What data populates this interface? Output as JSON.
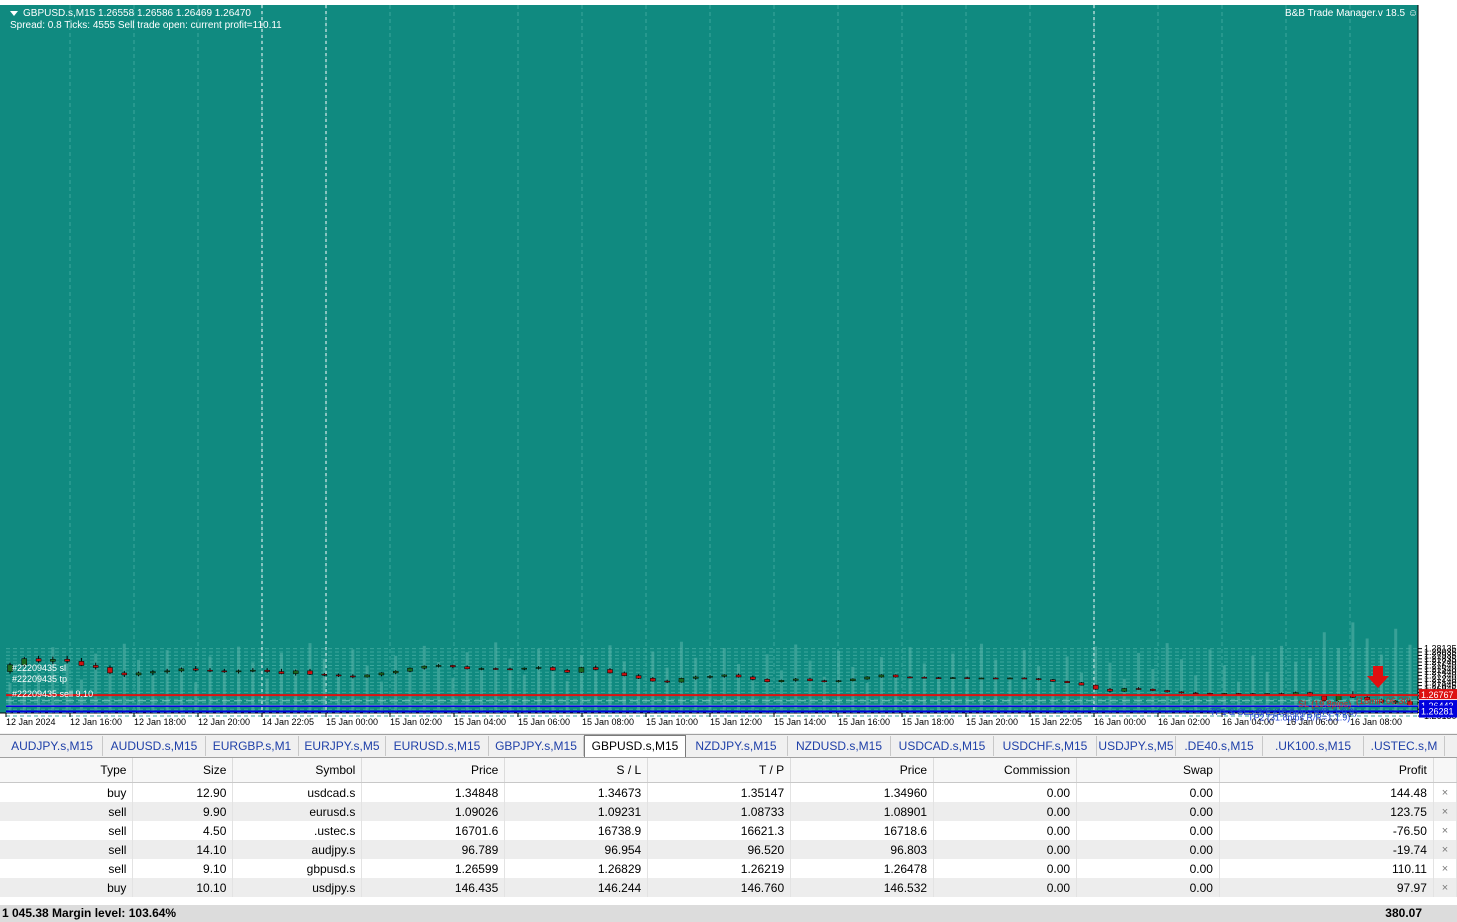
{
  "chart": {
    "symbol_line": "GBPUSD.s,M15  1.26558 1.26586 1.26469 1.26470",
    "status_line": "Spread: 0.8  Ticks: 4555  Sell trade open: current profit=110.11",
    "manager_label": "B&B Trade Manager.v 18.5",
    "line_labels": {
      "sl": "#22209435 sl",
      "entry": "#22209435 sell 9.10",
      "tp": "#22209435 tp",
      "sl_tag": "SL (19.8pips)",
      "tp1": "TP1 & SL->B/E (15.6pips R/R=1:0.9)",
      "tp2": "TP2 (31.8pips R/R=1:1.9)",
      "countdown": "(16min 06.30)"
    },
    "price_ticks": [
      "1.28135",
      "1.28035",
      "1.27935",
      "1.27835",
      "1.27740",
      "1.27640",
      "1.27540",
      "1.27440",
      "1.27340",
      "1.27240",
      "1.27140",
      "1.27045",
      "1.26945",
      "1.26845",
      "1.26745",
      "1.26645",
      "1.26545",
      "1.26350",
      "1.26250",
      "1.26150"
    ],
    "price_tags": {
      "sl": "1.26767",
      "current": "1.26470",
      "tp1": "1.26443",
      "tp2": "1.26281"
    },
    "time_labels": [
      "12 Jan 2024",
      "12 Jan 16:00",
      "12 Jan 18:00",
      "12 Jan 20:00",
      "14 Jan 22:05",
      "15 Jan 00:00",
      "15 Jan 02:00",
      "15 Jan 04:00",
      "15 Jan 06:00",
      "15 Jan 08:00",
      "15 Jan 10:00",
      "15 Jan 12:00",
      "15 Jan 14:00",
      "15 Jan 16:00",
      "15 Jan 18:00",
      "15 Jan 20:00",
      "15 Jan 22:05",
      "16 Jan 00:00",
      "16 Jan 02:00",
      "16 Jan 04:00",
      "16 Jan 06:00",
      "16 Jan 08:00"
    ],
    "colors": {
      "background": "#108a80",
      "bull": "#1e6a1e",
      "bear": "#cc1111",
      "sl_line": "#dd1111",
      "tp_line": "#0000dd",
      "text": "#ffffff"
    }
  },
  "tabs": [
    "AUDJPY.s,M15",
    "AUDUSD.s,M15",
    "EURGBP.s,M1",
    "EURJPY.s,M5",
    "EURUSD.s,M15",
    "GBPJPY.s,M15",
    "GBPUSD.s,M15",
    "NZDJPY.s,M15",
    "NZDUSD.s,M15",
    "USDCAD.s,M15",
    "USDCHF.s,M15",
    "USDJPY.s,M5",
    ".DE40.s,M15",
    ".UK100.s,M15",
    ".USTEC.s,M"
  ],
  "active_tab": 6,
  "table": {
    "headers": [
      "Type",
      "Size",
      "Symbol",
      "Price",
      "S / L",
      "T / P",
      "Price",
      "Commission",
      "Swap",
      "Profit"
    ],
    "rows": [
      [
        "buy",
        "12.90",
        "usdcad.s",
        "1.34848",
        "1.34673",
        "1.35147",
        "1.34960",
        "0.00",
        "0.00",
        "144.48"
      ],
      [
        "sell",
        "9.90",
        "eurusd.s",
        "1.09026",
        "1.09231",
        "1.08733",
        "1.08901",
        "0.00",
        "0.00",
        "123.75"
      ],
      [
        "sell",
        "4.50",
        ".ustec.s",
        "16701.6",
        "16738.9",
        "16621.3",
        "16718.6",
        "0.00",
        "0.00",
        "-76.50"
      ],
      [
        "sell",
        "14.10",
        "audjpy.s",
        "96.789",
        "96.954",
        "96.520",
        "96.803",
        "0.00",
        "0.00",
        "-19.74"
      ],
      [
        "sell",
        "9.10",
        "gbpusd.s",
        "1.26599",
        "1.26829",
        "1.26219",
        "1.26478",
        "0.00",
        "0.00",
        "110.11"
      ],
      [
        "buy",
        "10.10",
        "usdjpy.s",
        "146.435",
        "146.244",
        "146.760",
        "146.532",
        "0.00",
        "0.00",
        "97.97"
      ]
    ],
    "close_glyph": "×"
  },
  "footer": {
    "margin_text": "1 045.38  Margin level: 103.64%",
    "total_profit": "380.07"
  },
  "chart_data": {
    "type": "candlestick",
    "series": [
      {
        "ohlc": [
          [
            1.2746,
            1.2772,
            1.274,
            1.2766
          ],
          [
            1.2766,
            1.2789,
            1.276,
            1.2784
          ],
          [
            1.2784,
            1.2792,
            1.2772,
            1.2776
          ],
          [
            1.2776,
            1.279,
            1.2768,
            1.2782
          ],
          [
            1.2782,
            1.2792,
            1.277,
            1.2776
          ],
          [
            1.2776,
            1.2786,
            1.2762,
            1.2764
          ],
          [
            1.2764,
            1.2772,
            1.2752,
            1.2758
          ],
          [
            1.2758,
            1.2764,
            1.2738,
            1.2742
          ],
          [
            1.2742,
            1.2748,
            1.273,
            1.2736
          ],
          [
            1.2736,
            1.2746,
            1.2732,
            1.2742
          ],
          [
            1.2742,
            1.275,
            1.2736,
            1.2746
          ],
          [
            1.2746,
            1.2754,
            1.274,
            1.2748
          ],
          [
            1.2748,
            1.2758,
            1.2744,
            1.2754
          ],
          [
            1.2754,
            1.2762,
            1.2746,
            1.275
          ],
          [
            1.275,
            1.2756,
            1.2744,
            1.2748
          ],
          [
            1.2748,
            1.2754,
            1.2742,
            1.2746
          ],
          [
            1.2746,
            1.2752,
            1.274,
            1.2748
          ],
          [
            1.2748,
            1.2756,
            1.2744,
            1.275
          ],
          [
            1.275,
            1.2756,
            1.2742,
            1.2746
          ],
          [
            1.2746,
            1.2754,
            1.2738,
            1.274
          ],
          [
            1.274,
            1.2752,
            1.2734,
            1.2748
          ],
          [
            1.2748,
            1.2754,
            1.2736,
            1.2738
          ],
          [
            1.2738,
            1.2742,
            1.2732,
            1.2736
          ],
          [
            1.2736,
            1.274,
            1.273,
            1.2733
          ],
          [
            1.2733,
            1.2738,
            1.2726,
            1.273
          ],
          [
            1.273,
            1.2738,
            1.2728,
            1.2736
          ],
          [
            1.2736,
            1.2744,
            1.2732,
            1.2742
          ],
          [
            1.2742,
            1.275,
            1.2738,
            1.2747
          ],
          [
            1.2747,
            1.2758,
            1.2744,
            1.2756
          ],
          [
            1.2756,
            1.2764,
            1.2752,
            1.2762
          ],
          [
            1.2762,
            1.2768,
            1.2758,
            1.2764
          ],
          [
            1.2764,
            1.2766,
            1.2756,
            1.276
          ],
          [
            1.276,
            1.2764,
            1.2752,
            1.2754
          ],
          [
            1.2754,
            1.2758,
            1.275,
            1.2755
          ],
          [
            1.2755,
            1.2758,
            1.2751,
            1.2754
          ],
          [
            1.2754,
            1.2758,
            1.275,
            1.2753
          ],
          [
            1.2753,
            1.2758,
            1.275,
            1.2756
          ],
          [
            1.2756,
            1.2762,
            1.2752,
            1.2758
          ],
          [
            1.2758,
            1.2762,
            1.2748,
            1.275
          ],
          [
            1.275,
            1.2754,
            1.2742,
            1.2744
          ],
          [
            1.2744,
            1.276,
            1.2742,
            1.2758
          ],
          [
            1.2758,
            1.2764,
            1.275,
            1.2752
          ],
          [
            1.2752,
            1.2756,
            1.274,
            1.2742
          ],
          [
            1.2742,
            1.2746,
            1.2732,
            1.2734
          ],
          [
            1.2734,
            1.2738,
            1.2724,
            1.2726
          ],
          [
            1.2726,
            1.273,
            1.2716,
            1.2718
          ],
          [
            1.2718,
            1.2722,
            1.2712,
            1.2715
          ],
          [
            1.2715,
            1.2728,
            1.2713,
            1.2726
          ],
          [
            1.2726,
            1.2734,
            1.2722,
            1.273
          ],
          [
            1.273,
            1.2736,
            1.2725,
            1.2732
          ],
          [
            1.2732,
            1.2738,
            1.2728,
            1.2736
          ],
          [
            1.2736,
            1.274,
            1.2728,
            1.273
          ],
          [
            1.273,
            1.2734,
            1.272,
            1.2723
          ],
          [
            1.2723,
            1.2726,
            1.2714,
            1.2716
          ],
          [
            1.2716,
            1.2722,
            1.2714,
            1.272
          ],
          [
            1.272,
            1.2727,
            1.2716,
            1.2724
          ],
          [
            1.2724,
            1.2728,
            1.2717,
            1.2719
          ],
          [
            1.2719,
            1.2722,
            1.2714,
            1.2717
          ],
          [
            1.2717,
            1.2721,
            1.2714,
            1.2719
          ],
          [
            1.2719,
            1.2726,
            1.2717,
            1.2724
          ],
          [
            1.2724,
            1.2732,
            1.2722,
            1.273
          ],
          [
            1.273,
            1.2738,
            1.2728,
            1.2736
          ],
          [
            1.2736,
            1.2738,
            1.2728,
            1.273
          ],
          [
            1.273,
            1.2732,
            1.2726,
            1.2729
          ],
          [
            1.2729,
            1.2732,
            1.2726,
            1.2728
          ],
          [
            1.2728,
            1.273,
            1.2726,
            1.2727
          ],
          [
            1.2727,
            1.273,
            1.2725,
            1.2728
          ],
          [
            1.2728,
            1.2731,
            1.2725,
            1.2726
          ],
          [
            1.2726,
            1.2728,
            1.2724,
            1.2727
          ],
          [
            1.2727,
            1.2729,
            1.2725,
            1.27265
          ],
          [
            1.27265,
            1.2729,
            1.2725,
            1.2727
          ],
          [
            1.2727,
            1.2729,
            1.2724,
            1.2725
          ],
          [
            1.2725,
            1.2727,
            1.272,
            1.2722
          ],
          [
            1.2722,
            1.2724,
            1.2716,
            1.2717
          ],
          [
            1.2717,
            1.2719,
            1.2712,
            1.2713
          ],
          [
            1.2713,
            1.2715,
            1.2705,
            1.2706
          ],
          [
            1.2706,
            1.2708,
            1.2692,
            1.2694
          ],
          [
            1.2694,
            1.2698,
            1.2684,
            1.2688
          ],
          [
            1.2688,
            1.2698,
            1.2686,
            1.2696
          ],
          [
            1.2696,
            1.27,
            1.2692,
            1.2694
          ],
          [
            1.2694,
            1.2696,
            1.2688,
            1.269
          ],
          [
            1.269,
            1.2692,
            1.2684,
            1.2686
          ],
          [
            1.2686,
            1.2688,
            1.2681,
            1.2683
          ],
          [
            1.2683,
            1.2686,
            1.268,
            1.2682
          ],
          [
            1.2682,
            1.2684,
            1.2679,
            1.2681
          ],
          [
            1.2681,
            1.2683,
            1.2679,
            1.26815
          ],
          [
            1.26815,
            1.2683,
            1.2679,
            1.26805
          ],
          [
            1.26805,
            1.2683,
            1.2678,
            1.2679
          ],
          [
            1.2679,
            1.2682,
            1.2677,
            1.2681
          ],
          [
            1.2681,
            1.2684,
            1.2677,
            1.2678
          ],
          [
            1.2678,
            1.2687,
            1.2676,
            1.2684
          ],
          [
            1.2684,
            1.2687,
            1.2672,
            1.2674
          ],
          [
            1.2674,
            1.2676,
            1.2658,
            1.266
          ],
          [
            1.266,
            1.268,
            1.2656,
            1.2678
          ],
          [
            1.2678,
            1.2688,
            1.2668,
            1.267
          ],
          [
            1.267,
            1.2674,
            1.266,
            1.2662
          ],
          [
            1.2662,
            1.2666,
            1.2654,
            1.2656
          ],
          [
            1.2656,
            1.2662,
            1.265,
            1.2659
          ],
          [
            1.2659,
            1.2664,
            1.2647,
            1.2647
          ]
        ]
      }
    ],
    "xlabel": "",
    "ylabel": "",
    "ylim": [
      1.261,
      1.282
    ],
    "levels": {
      "sl": 1.26767,
      "entry": 1.26599,
      "tp1": 1.26443,
      "tp2": 1.26281
    }
  }
}
